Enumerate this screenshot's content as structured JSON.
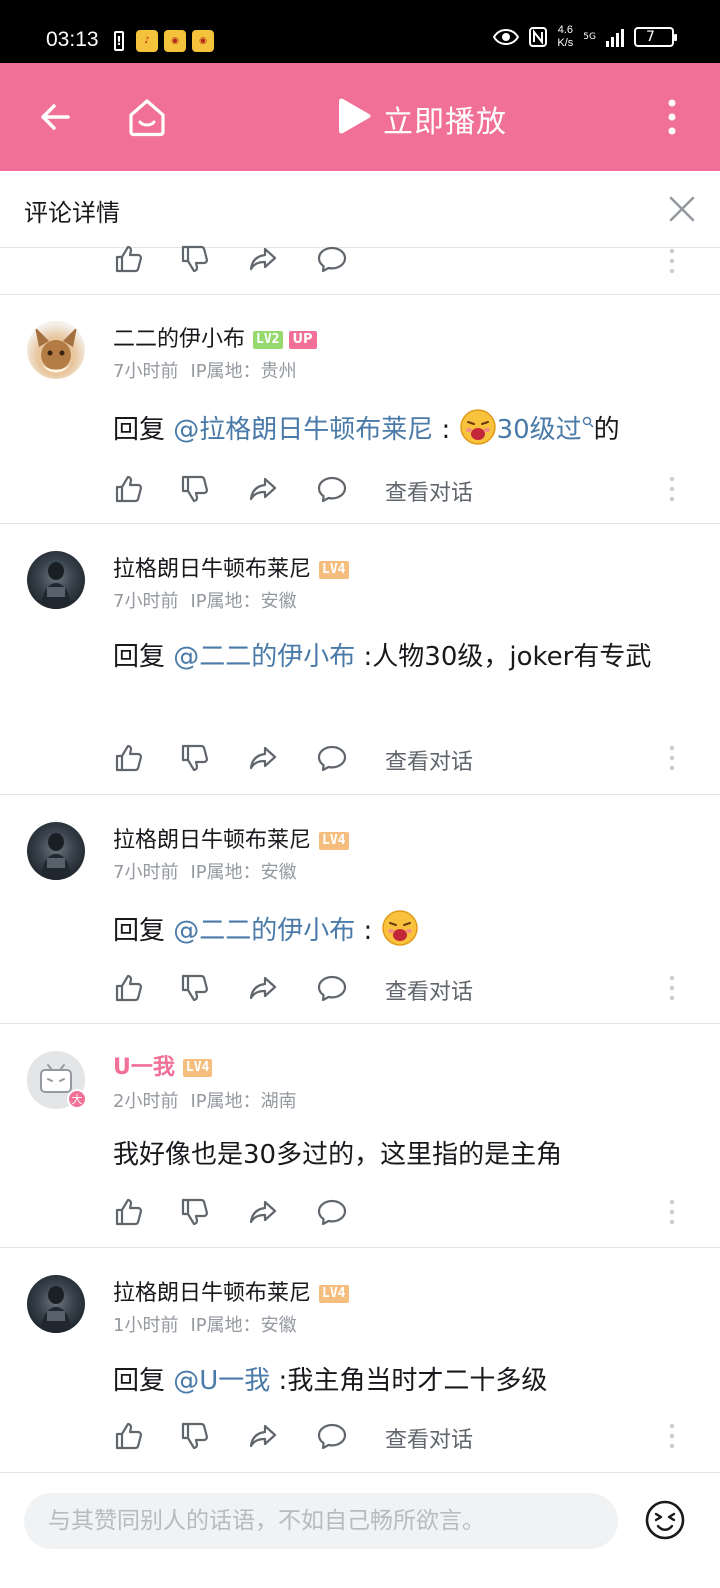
{
  "status_bar": {
    "time": "03:13",
    "speed": "4.6",
    "speed_unit": "K/s",
    "network": "5G",
    "battery": "7"
  },
  "topbar": {
    "play_label": "立即播放",
    "icons": [
      "back-arrow-icon",
      "home-icon",
      "play-icon",
      "more-vertical-icon"
    ],
    "bg_color": "#f07097"
  },
  "subheader": {
    "title": "评论详情"
  },
  "actions": {
    "view_dialog": "查看对话"
  },
  "comments": [
    {
      "user": "二二的伊小布",
      "level": "LV2",
      "up_badge": "UP",
      "time": "7小时前",
      "ip": "IP属地：贵州",
      "reply_prefix": "回复 ",
      "mention": "@拉格朗日牛顿布莱尼",
      "sep": " :",
      "text_link": "30级过",
      "text_after": "的"
    },
    {
      "user": "拉格朗日牛顿布莱尼",
      "level": "LV4",
      "time": "7小时前",
      "ip": "IP属地：安徽",
      "reply_prefix": "回复 ",
      "mention": "@二二的伊小布",
      "text": " :人物30级，joker有专武"
    },
    {
      "user": "拉格朗日牛顿布莱尼",
      "level": "LV4",
      "time": "7小时前",
      "ip": "IP属地：安徽",
      "reply_prefix": "回复 ",
      "mention": "@二二的伊小布",
      "sep": " :"
    },
    {
      "user": "U一我",
      "level": "LV4",
      "time": "2小时前",
      "ip": "IP属地：湖南",
      "text": "我好像也是30多过的，这里指的是主角"
    },
    {
      "user": "拉格朗日牛顿布莱尼",
      "level": "LV4",
      "time": "1小时前",
      "ip": "IP属地：安徽",
      "reply_prefix": "回复 ",
      "mention": "@U一我",
      "text": " :我主角当时才二十多级"
    }
  ],
  "input": {
    "placeholder": "与其赞同别人的话语，不如自己畅所欲言。"
  }
}
